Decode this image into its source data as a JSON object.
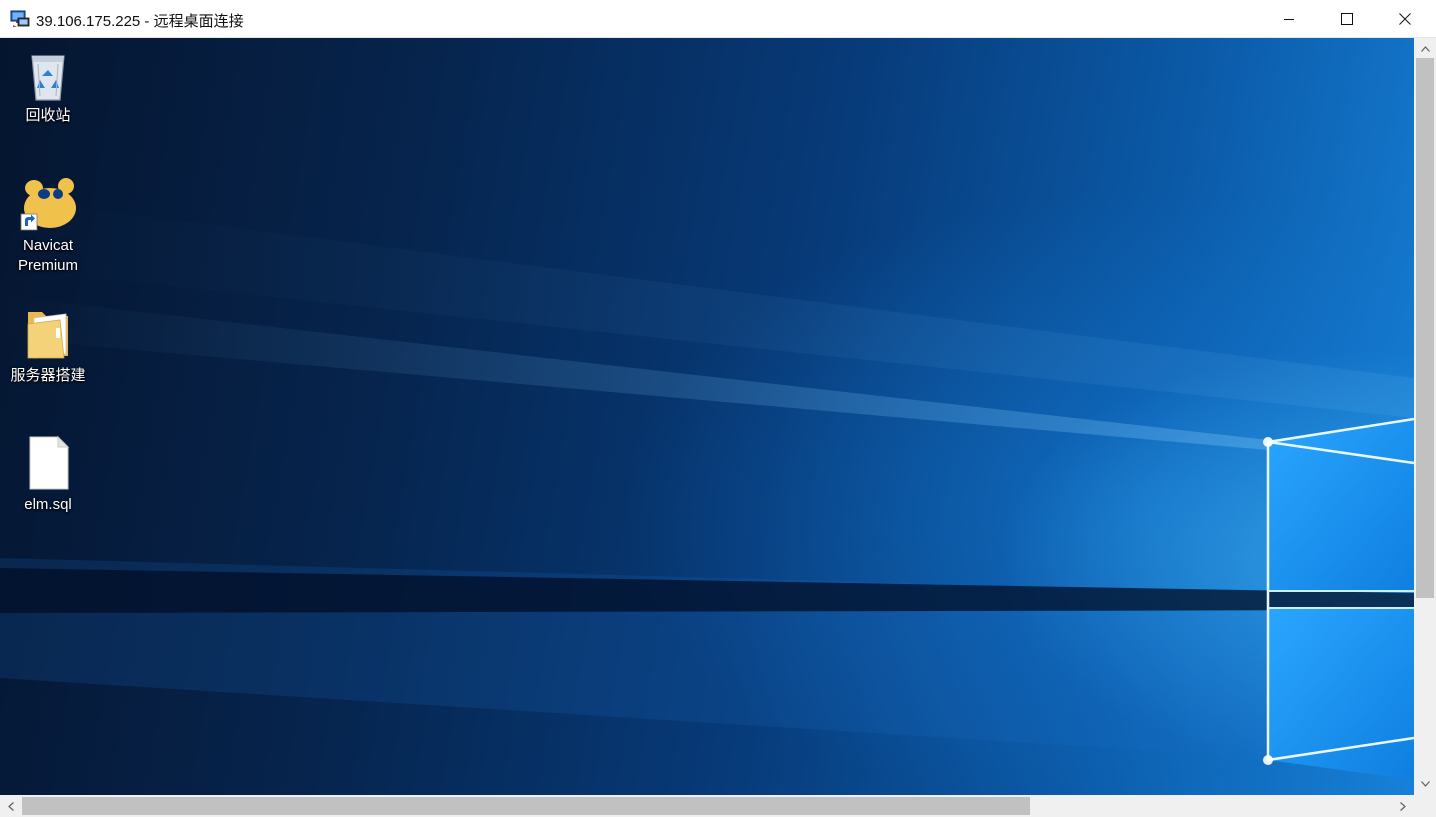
{
  "window": {
    "title": "39.106.175.225 - 远程桌面连接",
    "icon": "remote-desktop-icon",
    "controls": [
      "minimize-icon",
      "maximize-icon",
      "close-icon"
    ]
  },
  "desktop": {
    "icons": [
      {
        "name": "recycle-bin",
        "icon": "recycle-bin-icon",
        "label": "回收站"
      },
      {
        "name": "navicat-premium",
        "icon": "navicat-icon",
        "label": "Navicat Premium",
        "shortcut": true
      },
      {
        "name": "server-setup-folder",
        "icon": "folder-icon",
        "label": "服务器搭建"
      },
      {
        "name": "elm-sql-file",
        "icon": "file-icon",
        "label": "elm.sql"
      }
    ]
  },
  "colors": {
    "wallpaper_dark": "#05152f",
    "wallpaper_light": "#1781d8",
    "navicat_yellow": "#f0c24b",
    "folder_yellow": "#f3d27a"
  }
}
